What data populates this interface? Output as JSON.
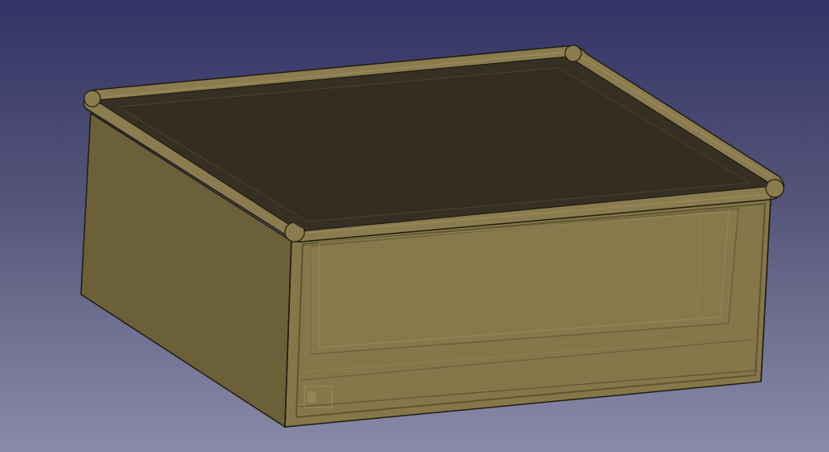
{
  "viewport": {
    "background_top": "#333366",
    "background_bottom": "#8a8aa8"
  },
  "model": {
    "type": "box-with-lid",
    "display_mode": "transparent-shaded",
    "body_color": "#7d7045",
    "body_side_color": "#6b6038",
    "lid_top_color": "#363024",
    "lid_rim_color": "#8a7c4e",
    "edge_color": "#1f1c12"
  }
}
